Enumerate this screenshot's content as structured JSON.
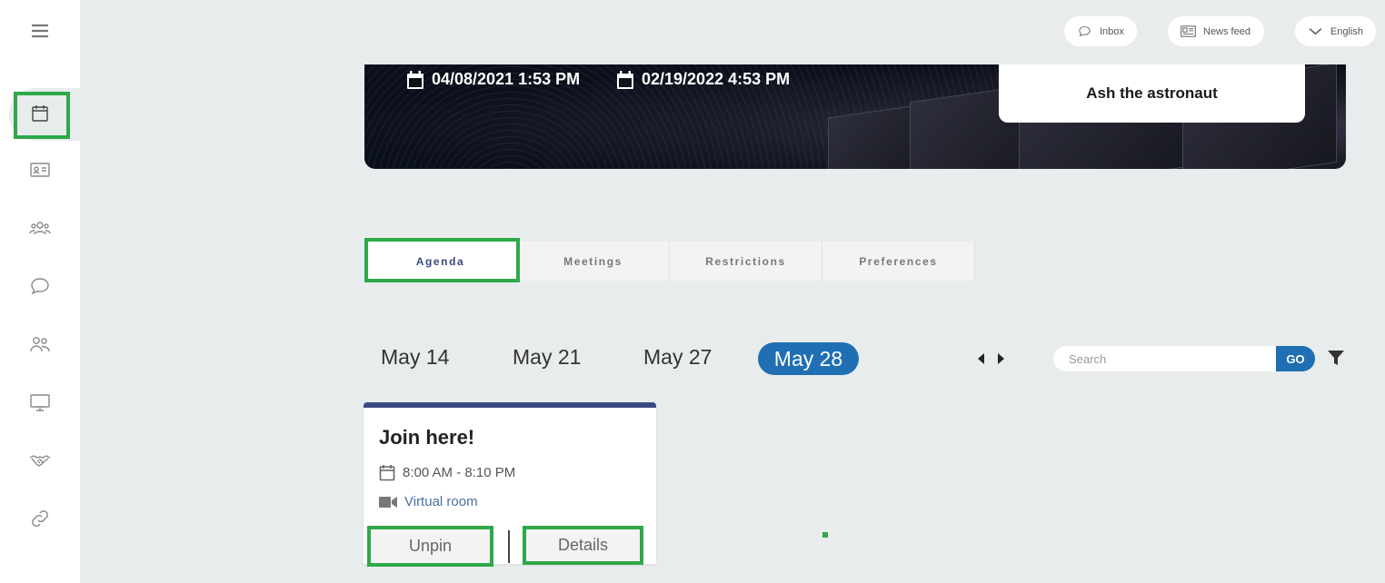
{
  "header": {
    "inbox_label": "Inbox",
    "newsfeed_label": "News feed",
    "language_label": "English"
  },
  "banner": {
    "start_datetime": "04/08/2021 1:53 PM",
    "end_datetime": "02/19/2022 4:53 PM",
    "host_name": "Ash the astronaut"
  },
  "tabs": [
    {
      "label": "Agenda",
      "active": true
    },
    {
      "label": "Meetings",
      "active": false
    },
    {
      "label": "Restrictions",
      "active": false
    },
    {
      "label": "Preferences",
      "active": false
    }
  ],
  "days": [
    {
      "label": "May 14",
      "active": false
    },
    {
      "label": "May 21",
      "active": false
    },
    {
      "label": "May 27",
      "active": false
    },
    {
      "label": "May 28",
      "active": true
    }
  ],
  "search": {
    "placeholder": "Search",
    "go_label": "GO"
  },
  "session": {
    "title": "Join here!",
    "time": "8:00 AM - 8:10 PM",
    "location": "Virtual room",
    "unpin_label": "Unpin",
    "details_label": "Details"
  },
  "sidebar": {
    "items": [
      "menu-icon",
      "calendar-icon",
      "id-card-icon",
      "group-icon",
      "chat-icon",
      "people-icon",
      "monitor-icon",
      "handshake-icon",
      "link-icon"
    ]
  },
  "colors": {
    "accent_blue": "#1f6fb2",
    "tab_active_text": "#3a4a82",
    "highlight_green": "#2ea84a",
    "page_bg": "#e9ecec"
  }
}
